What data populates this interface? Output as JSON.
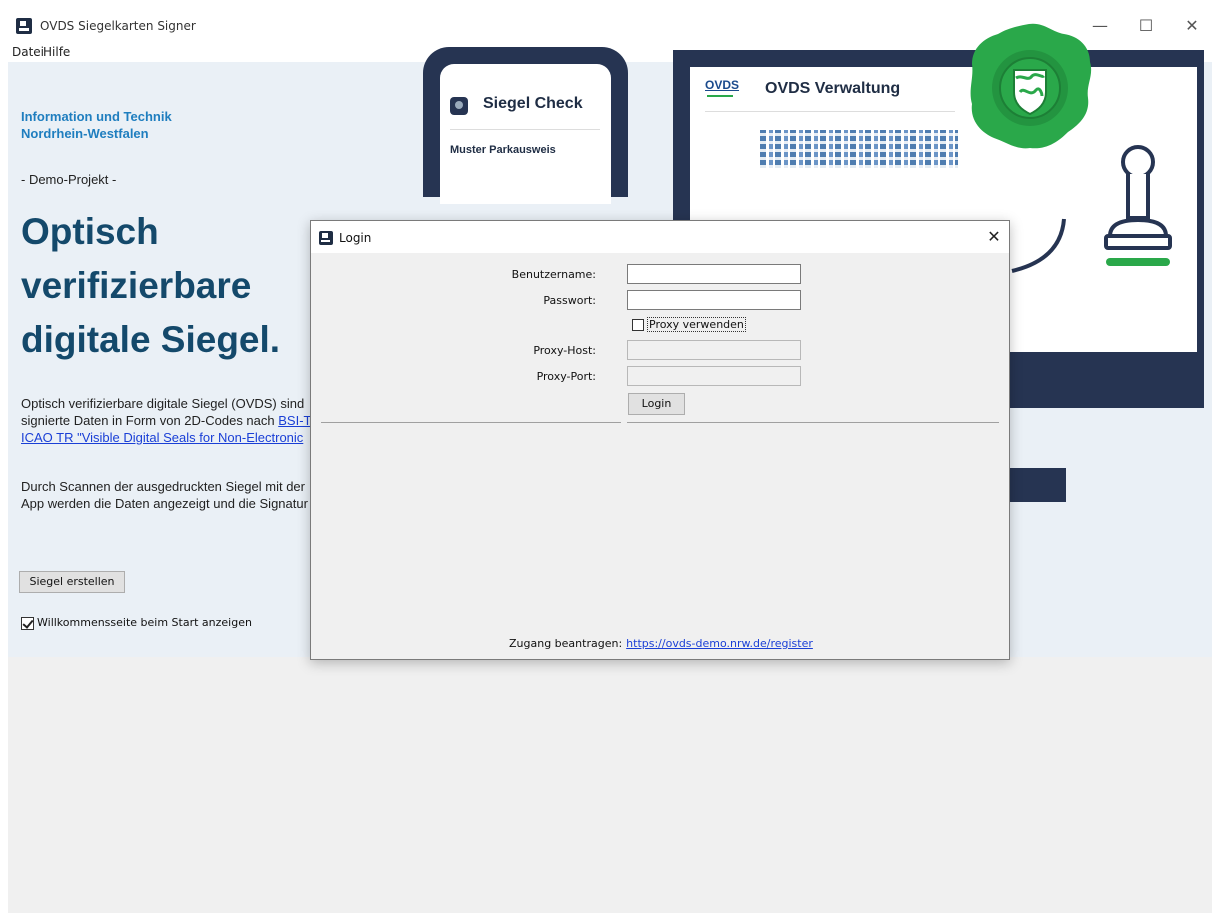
{
  "window": {
    "title": "OVDS Siegelkarten Signer",
    "controls": {
      "minimize": "—",
      "maximize": "☐",
      "close": "✕"
    }
  },
  "menu": [
    "Datei",
    "Hilfe"
  ],
  "welcome": {
    "org_line1": "Information und Technik",
    "org_line2": "Nordrhein-Westfalen",
    "demo": "- Demo-Projekt -",
    "headline": [
      "Optisch",
      "verifizierbare",
      "digitale Siegel."
    ],
    "para1": {
      "line1": "Optisch verifizierbare digitale Siegel (OVDS) sind",
      "line2_text": "signierte Daten in Form von 2D-Codes nach ",
      "line2_link": "BSI-T",
      "line3_link": "ICAO TR \"Visible Digital Seals for Non-Electronic"
    },
    "para2": {
      "line1": "Durch Scannen der ausgedruckten Siegel mit der",
      "line2": "App werden die Daten angezeigt und die Signatur"
    },
    "create_button": "Siegel erstellen",
    "show_welcome_label": "Willkommensseite beim Start anzeigen",
    "show_welcome_checked": true
  },
  "illustration": {
    "phone_title": "Siegel Check",
    "phone_subtitle": "Muster Parkausweis",
    "monitor_brand": "OVDS",
    "monitor_title": "OVDS Verwaltung",
    "colors": {
      "navy": "#263452",
      "seal_green": "#2aa84a",
      "accent_blue": "#1f7ebf"
    }
  },
  "login_dialog": {
    "title": "Login",
    "close": "✕",
    "username_label": "Benutzername:",
    "username_value": "",
    "password_label": "Passwort:",
    "password_value": "",
    "proxy_label": "Proxy verwenden",
    "proxy_checked": false,
    "proxy_host_label": "Proxy-Host:",
    "proxy_host_value": "",
    "proxy_port_label": "Proxy-Port:",
    "proxy_port_value": "",
    "login_button": "Login",
    "footer_text": "Zugang beantragen:",
    "footer_link": "https://ovds-demo.nrw.de/register"
  }
}
